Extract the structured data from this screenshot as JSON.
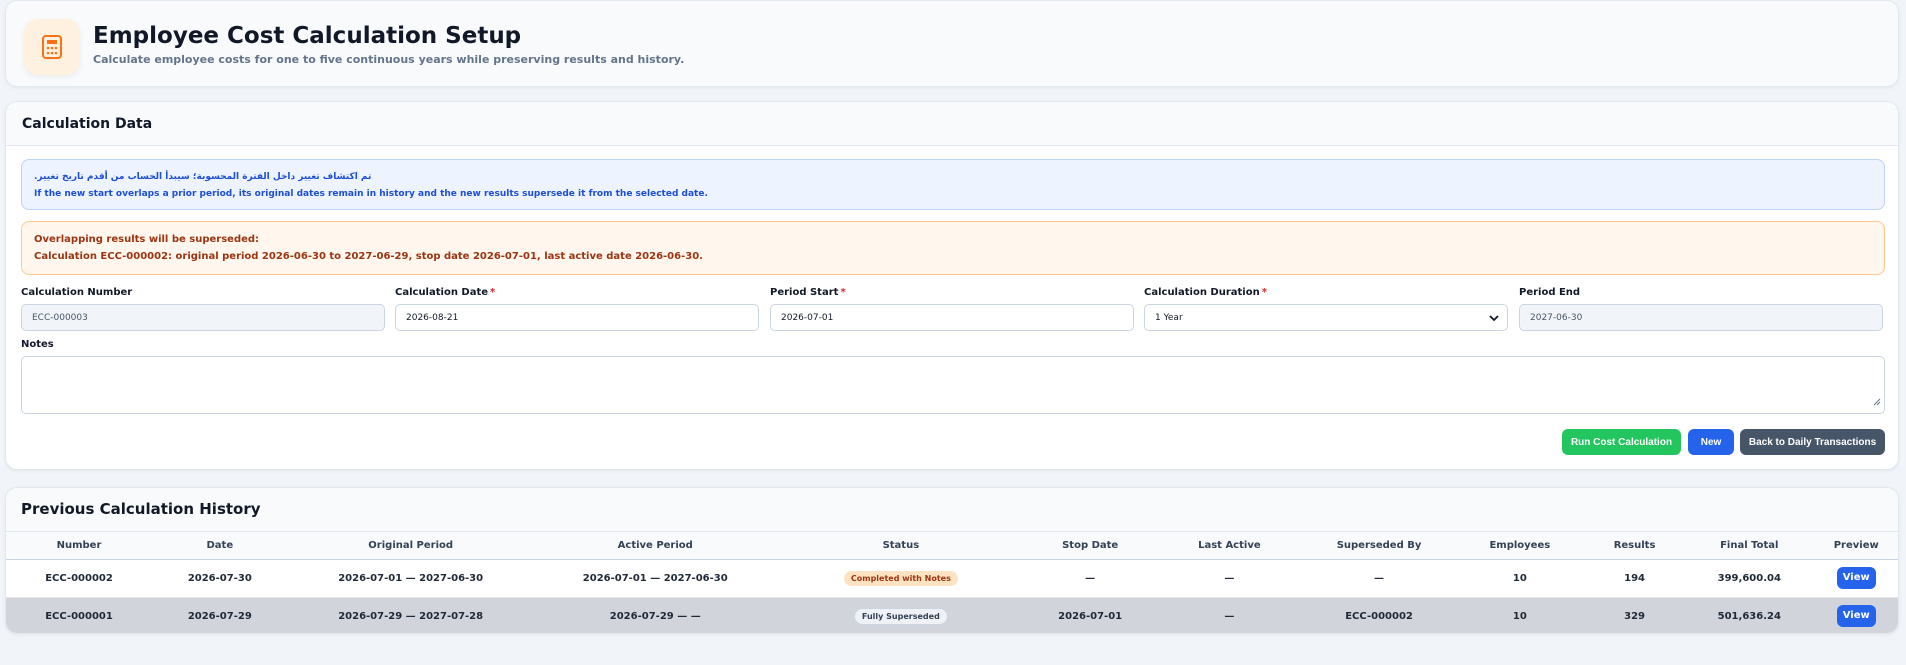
{
  "header": {
    "icon": "calculator-icon",
    "title": "Employee Cost Calculation Setup",
    "subtitle": "Calculate employee costs for one to five continuous years while preserving results and history."
  },
  "calc": {
    "section_title": "Calculation Data",
    "info_line1": "تم اكتشاف تغيير داخل الفترة المحسوبة؛ سيبدأ الحساب من أقدم تاريخ تغيير.",
    "info_line2": "If the new start overlaps a prior period, its original dates remain in history and the new results supersede it from the selected date.",
    "warn_line1": "Overlapping results will be superseded:",
    "warn_line2": "Calculation ECC-000002: original period 2026-06-30 to 2027-06-29, stop date 2026-07-01, last active date 2026-06-30.",
    "fields": {
      "number_label": "Calculation Number",
      "number_value": "ECC-000003",
      "date_label": "Calculation Date",
      "date_value": "2026-08-21",
      "start_label": "Period Start",
      "start_value": "2026-07-01",
      "duration_label": "Calculation Duration",
      "duration_value": "1 Year",
      "end_label": "Period End",
      "end_value": "2027-06-30",
      "required_mark": "*"
    },
    "notes_label": "Notes",
    "notes_value": "",
    "buttons": {
      "run": "Run Cost Calculation",
      "new": "New",
      "back": "Back to Daily Transactions"
    }
  },
  "history": {
    "title": "Previous Calculation History",
    "columns": [
      "Number",
      "Date",
      "Original Period",
      "Active Period",
      "Status",
      "Stop Date",
      "Last Active",
      "Superseded By",
      "Employees",
      "Results",
      "Final Total",
      "Preview"
    ],
    "rows": [
      {
        "number": "ECC-000002",
        "date": "2026-07-30",
        "original_period": "2026-07-01 — 2027-06-30",
        "active_period": "2026-07-01 — 2027-06-30",
        "status": "Completed with Notes",
        "stop_date": "—",
        "last_active": "—",
        "superseded_by": "—",
        "employees": "10",
        "results": "194",
        "final_total": "399,600.04",
        "preview": "View"
      },
      {
        "number": "ECC-000001",
        "date": "2026-07-29",
        "original_period": "2026-07-29 — 2027-07-28",
        "active_period": "2026-07-29 — —",
        "status": "Fully Superseded",
        "stop_date": "2026-07-01",
        "last_active": "—",
        "superseded_by": "ECC-000002",
        "employees": "10",
        "results": "329",
        "final_total": "501,636.24",
        "preview": "View"
      }
    ]
  },
  "colors": {
    "accent_blue": "#2563eb",
    "run_green": "#22c55e",
    "back_slate": "#475569",
    "info_bg": "#eef4ff",
    "warn_bg": "#fff7ed",
    "icon_orange": "#f97316"
  }
}
